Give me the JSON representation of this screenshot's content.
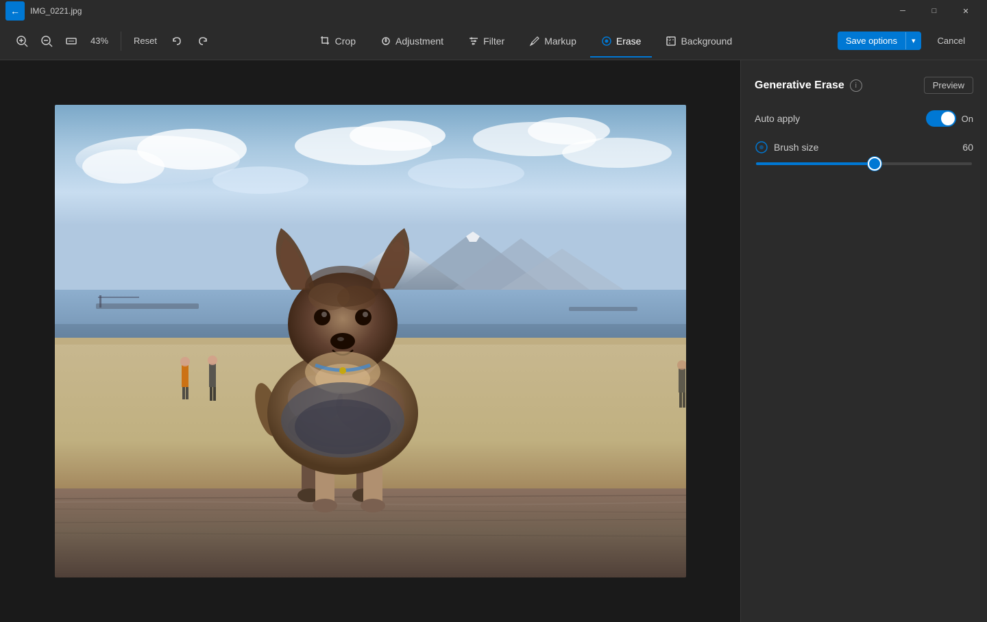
{
  "titlebar": {
    "filename": "IMG_0221.jpg",
    "minimize_label": "─",
    "maximize_label": "□",
    "close_label": "✕",
    "back_icon": "←"
  },
  "toolbar": {
    "zoom_in_icon": "🔍+",
    "zoom_out_icon": "🔍-",
    "aspect_icon": "▣",
    "zoom_level": "43%",
    "reset_label": "Reset",
    "undo_icon": "↩",
    "redo_icon": "↪",
    "tabs": [
      {
        "id": "crop",
        "label": "Crop",
        "icon": "⬚",
        "active": false
      },
      {
        "id": "adjustment",
        "label": "Adjustment",
        "icon": "☀",
        "active": false
      },
      {
        "id": "filter",
        "label": "Filter",
        "icon": "⬡",
        "active": false
      },
      {
        "id": "markup",
        "label": "Markup",
        "icon": "✏",
        "active": false
      },
      {
        "id": "erase",
        "label": "Erase",
        "icon": "◉",
        "active": true
      },
      {
        "id": "background",
        "label": "Background",
        "icon": "⬜",
        "active": false
      }
    ],
    "save_options_label": "Save options",
    "save_chevron": "▾",
    "cancel_label": "Cancel"
  },
  "panel": {
    "title": "Generative Erase",
    "info_icon": "ⓘ",
    "preview_label": "Preview",
    "auto_apply_label": "Auto apply",
    "toggle_on_label": "On",
    "brush_size_label": "Brush size",
    "brush_size_value": "60",
    "slider_percent": 55
  },
  "colors": {
    "accent": "#0078d4",
    "bg_dark": "#1e1e1e",
    "bg_panel": "#2b2b2b",
    "text_primary": "#ffffff",
    "text_secondary": "#cccccc"
  }
}
